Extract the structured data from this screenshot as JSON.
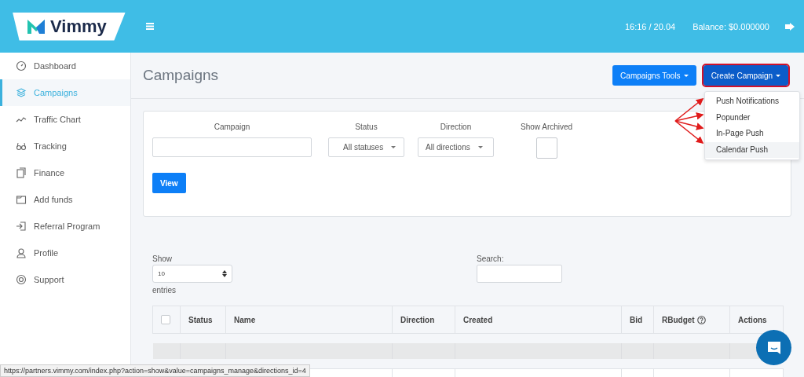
{
  "header": {
    "logo": "Vimmy",
    "time": "16:16 / 20.04",
    "balance": "Balance: $0.000000"
  },
  "sidebar": {
    "items": [
      {
        "label": "Dashboard",
        "selected": false
      },
      {
        "label": "Campaigns",
        "selected": true
      },
      {
        "label": "Traffic Chart",
        "selected": false
      },
      {
        "label": "Tracking",
        "selected": false
      },
      {
        "label": "Finance",
        "selected": false
      },
      {
        "label": "Add funds",
        "selected": false
      },
      {
        "label": "Referral Program",
        "selected": false
      },
      {
        "label": "Profile",
        "selected": false
      },
      {
        "label": "Support",
        "selected": false
      }
    ]
  },
  "page_title": "Campaigns",
  "toolbar": {
    "buttons": [
      {
        "label": "Campaigns Tools",
        "highlighted": false
      },
      {
        "label": "Create Campaign",
        "highlighted": true
      }
    ]
  },
  "dropdown": {
    "items": [
      {
        "label": "Push Notifications",
        "selected": false
      },
      {
        "label": "Popunder",
        "selected": false
      },
      {
        "label": "In-Page Push",
        "selected": false
      },
      {
        "label": "Calendar Push",
        "selected": true
      }
    ]
  },
  "filters": {
    "campaign_label": "Campaign",
    "status_label": "Status",
    "status_value": "All statuses",
    "direction_label": "Direction",
    "direction_value": "All directions",
    "archived_label": "Show Archived",
    "archived_checked": false,
    "view_button": "View"
  },
  "table": {
    "show_label": "Show",
    "page_size": "10",
    "entries_label": "entries",
    "search_label": "Search:",
    "select_all_checked": false,
    "columns": [
      "Status",
      "Name",
      "Direction",
      "Created",
      "Bid",
      "RBudget",
      "Actions"
    ]
  },
  "status_bar": {
    "url": "https://partners.vimmy.com/index.php?action=show&value=campaigns_manage&directions_id=4"
  }
}
